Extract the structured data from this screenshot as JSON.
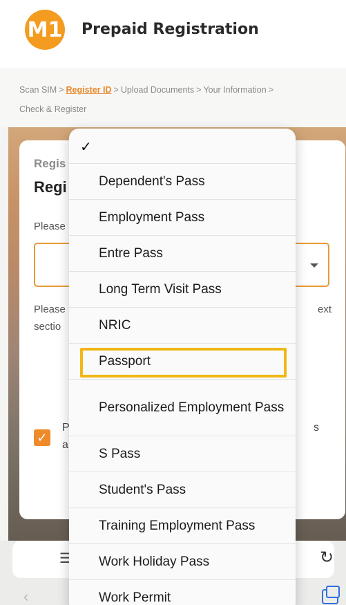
{
  "header": {
    "logo_text": "M1",
    "title": "Prepaid Registration"
  },
  "breadcrumb": {
    "steps": [
      "Scan SIM",
      "Register ID",
      "Upload Documents",
      "Your Information",
      "Check & Register"
    ],
    "active_index": 1,
    "separator": ">"
  },
  "card": {
    "kicker_partial": "Regis",
    "title_partial": "Regi",
    "prompt_partial": "Please",
    "note_line1_partial": "Please",
    "note_line2_partial": "sectio",
    "note_end_partial": "ext",
    "consent_line1_partial": "P",
    "consent_line2_partial": "a",
    "consent_end_partial": "s",
    "consent_checked": true
  },
  "picker": {
    "checkmark": "✓",
    "options": [
      "Dependent's Pass",
      "Employment Pass",
      "Entre Pass",
      "Long Term Visit Pass",
      "NRIC",
      "Passport",
      "Personalized Employment Pass",
      "S Pass",
      "Student's Pass",
      "Training Employment Pass",
      "Work Holiday Pass",
      "Work Permit"
    ],
    "highlighted_option": "Passport"
  },
  "toolbar": {
    "tab_icon": "tab-overview-icon",
    "reload_icon": "reload-icon",
    "back_icon": "back-chevron-icon",
    "tabs_icon": "tabs-icon"
  },
  "colors": {
    "brand_orange": "#f39c1f",
    "active_crumb": "#e8892a",
    "highlight": "#f1b718",
    "select_border": "#e89a3b"
  }
}
